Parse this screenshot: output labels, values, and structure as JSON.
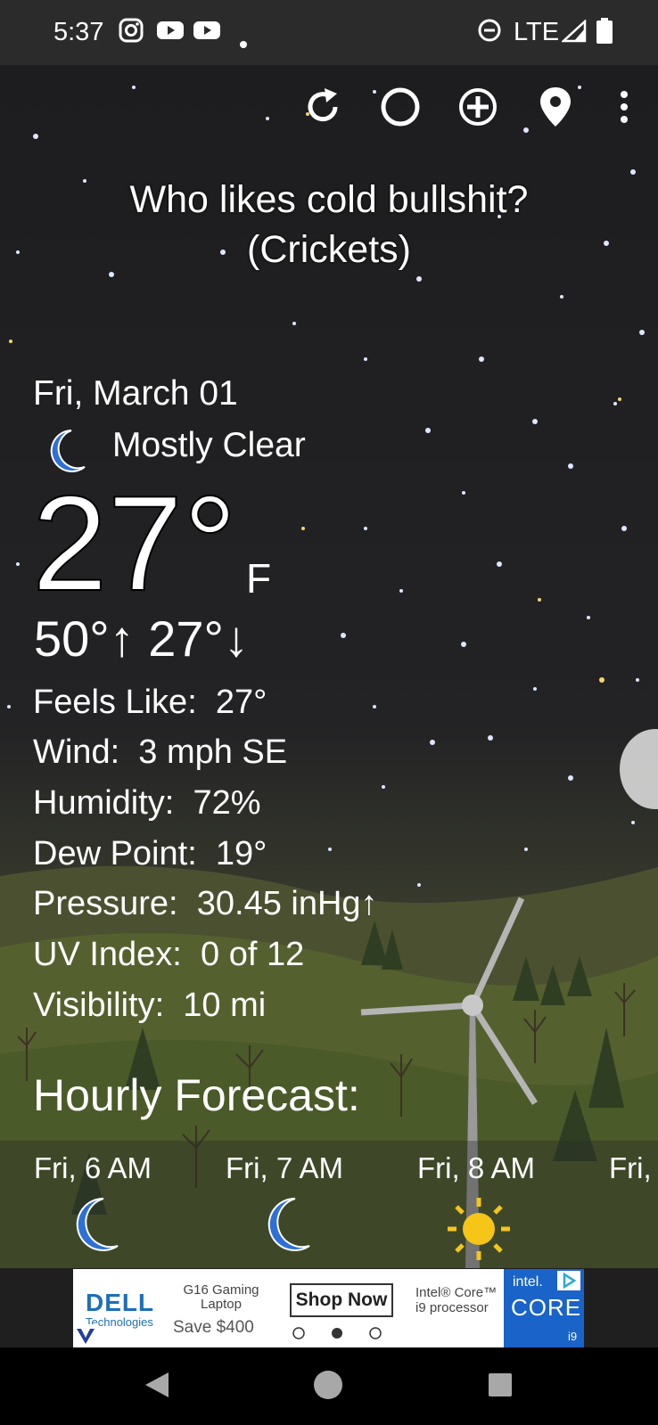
{
  "status_bar": {
    "time": "5:37",
    "network": "LTE",
    "icons": [
      "instagram-icon",
      "youtube-icon",
      "youtube-icon",
      "dot-icon",
      "do-not-disturb-icon",
      "signal-icon",
      "battery-icon"
    ]
  },
  "toolbar": {
    "icons": [
      "refresh-icon",
      "moon-phase-icon",
      "add-location-icon",
      "location-pin-icon",
      "more-vert-icon"
    ]
  },
  "quote": {
    "line1": "Who likes cold bullshit?",
    "line2": "(Crickets)"
  },
  "current": {
    "date": "Fri, March 01",
    "condition": "Mostly Clear",
    "condition_icon": "moon-icon",
    "temperature": "27°",
    "unit": "F",
    "high": "50°↑",
    "low": "27°↓"
  },
  "details": [
    {
      "label": "Feels Like:",
      "value": "27°"
    },
    {
      "label": "Wind:",
      "value": "3 mph SE"
    },
    {
      "label": "Humidity:",
      "value": "72%"
    },
    {
      "label": "Dew Point:",
      "value": "19°"
    },
    {
      "label": "Pressure:",
      "value": "30.45 inHg↑"
    },
    {
      "label": "UV Index:",
      "value": "0 of 12"
    },
    {
      "label": "Visibility:",
      "value": "10 mi"
    }
  ],
  "hourly": {
    "title": "Hourly Forecast:",
    "items": [
      {
        "label": "Fri, 6 AM",
        "icon": "moon-icon"
      },
      {
        "label": "Fri, 7 AM",
        "icon": "moon-icon"
      },
      {
        "label": "Fri, 8 AM",
        "icon": "sun-icon"
      },
      {
        "label": "Fri,",
        "icon": "sun-icon"
      }
    ]
  },
  "ad": {
    "brand": "DELL",
    "brand_sub": "Technologies",
    "product": "G16 Gaming Laptop",
    "offer": "Save $400",
    "cta": "Shop Now",
    "processor_text": "Intel® Core™ i9 processor",
    "intel_label": "intel.",
    "core_label": "CORE",
    "tier": "i9"
  },
  "colors": {
    "moon_blue": "#2f6fd8",
    "sun_yellow": "#f5c518",
    "status_bar_bg": "#2b2b2b",
    "nav_bar_bg": "#000000"
  }
}
